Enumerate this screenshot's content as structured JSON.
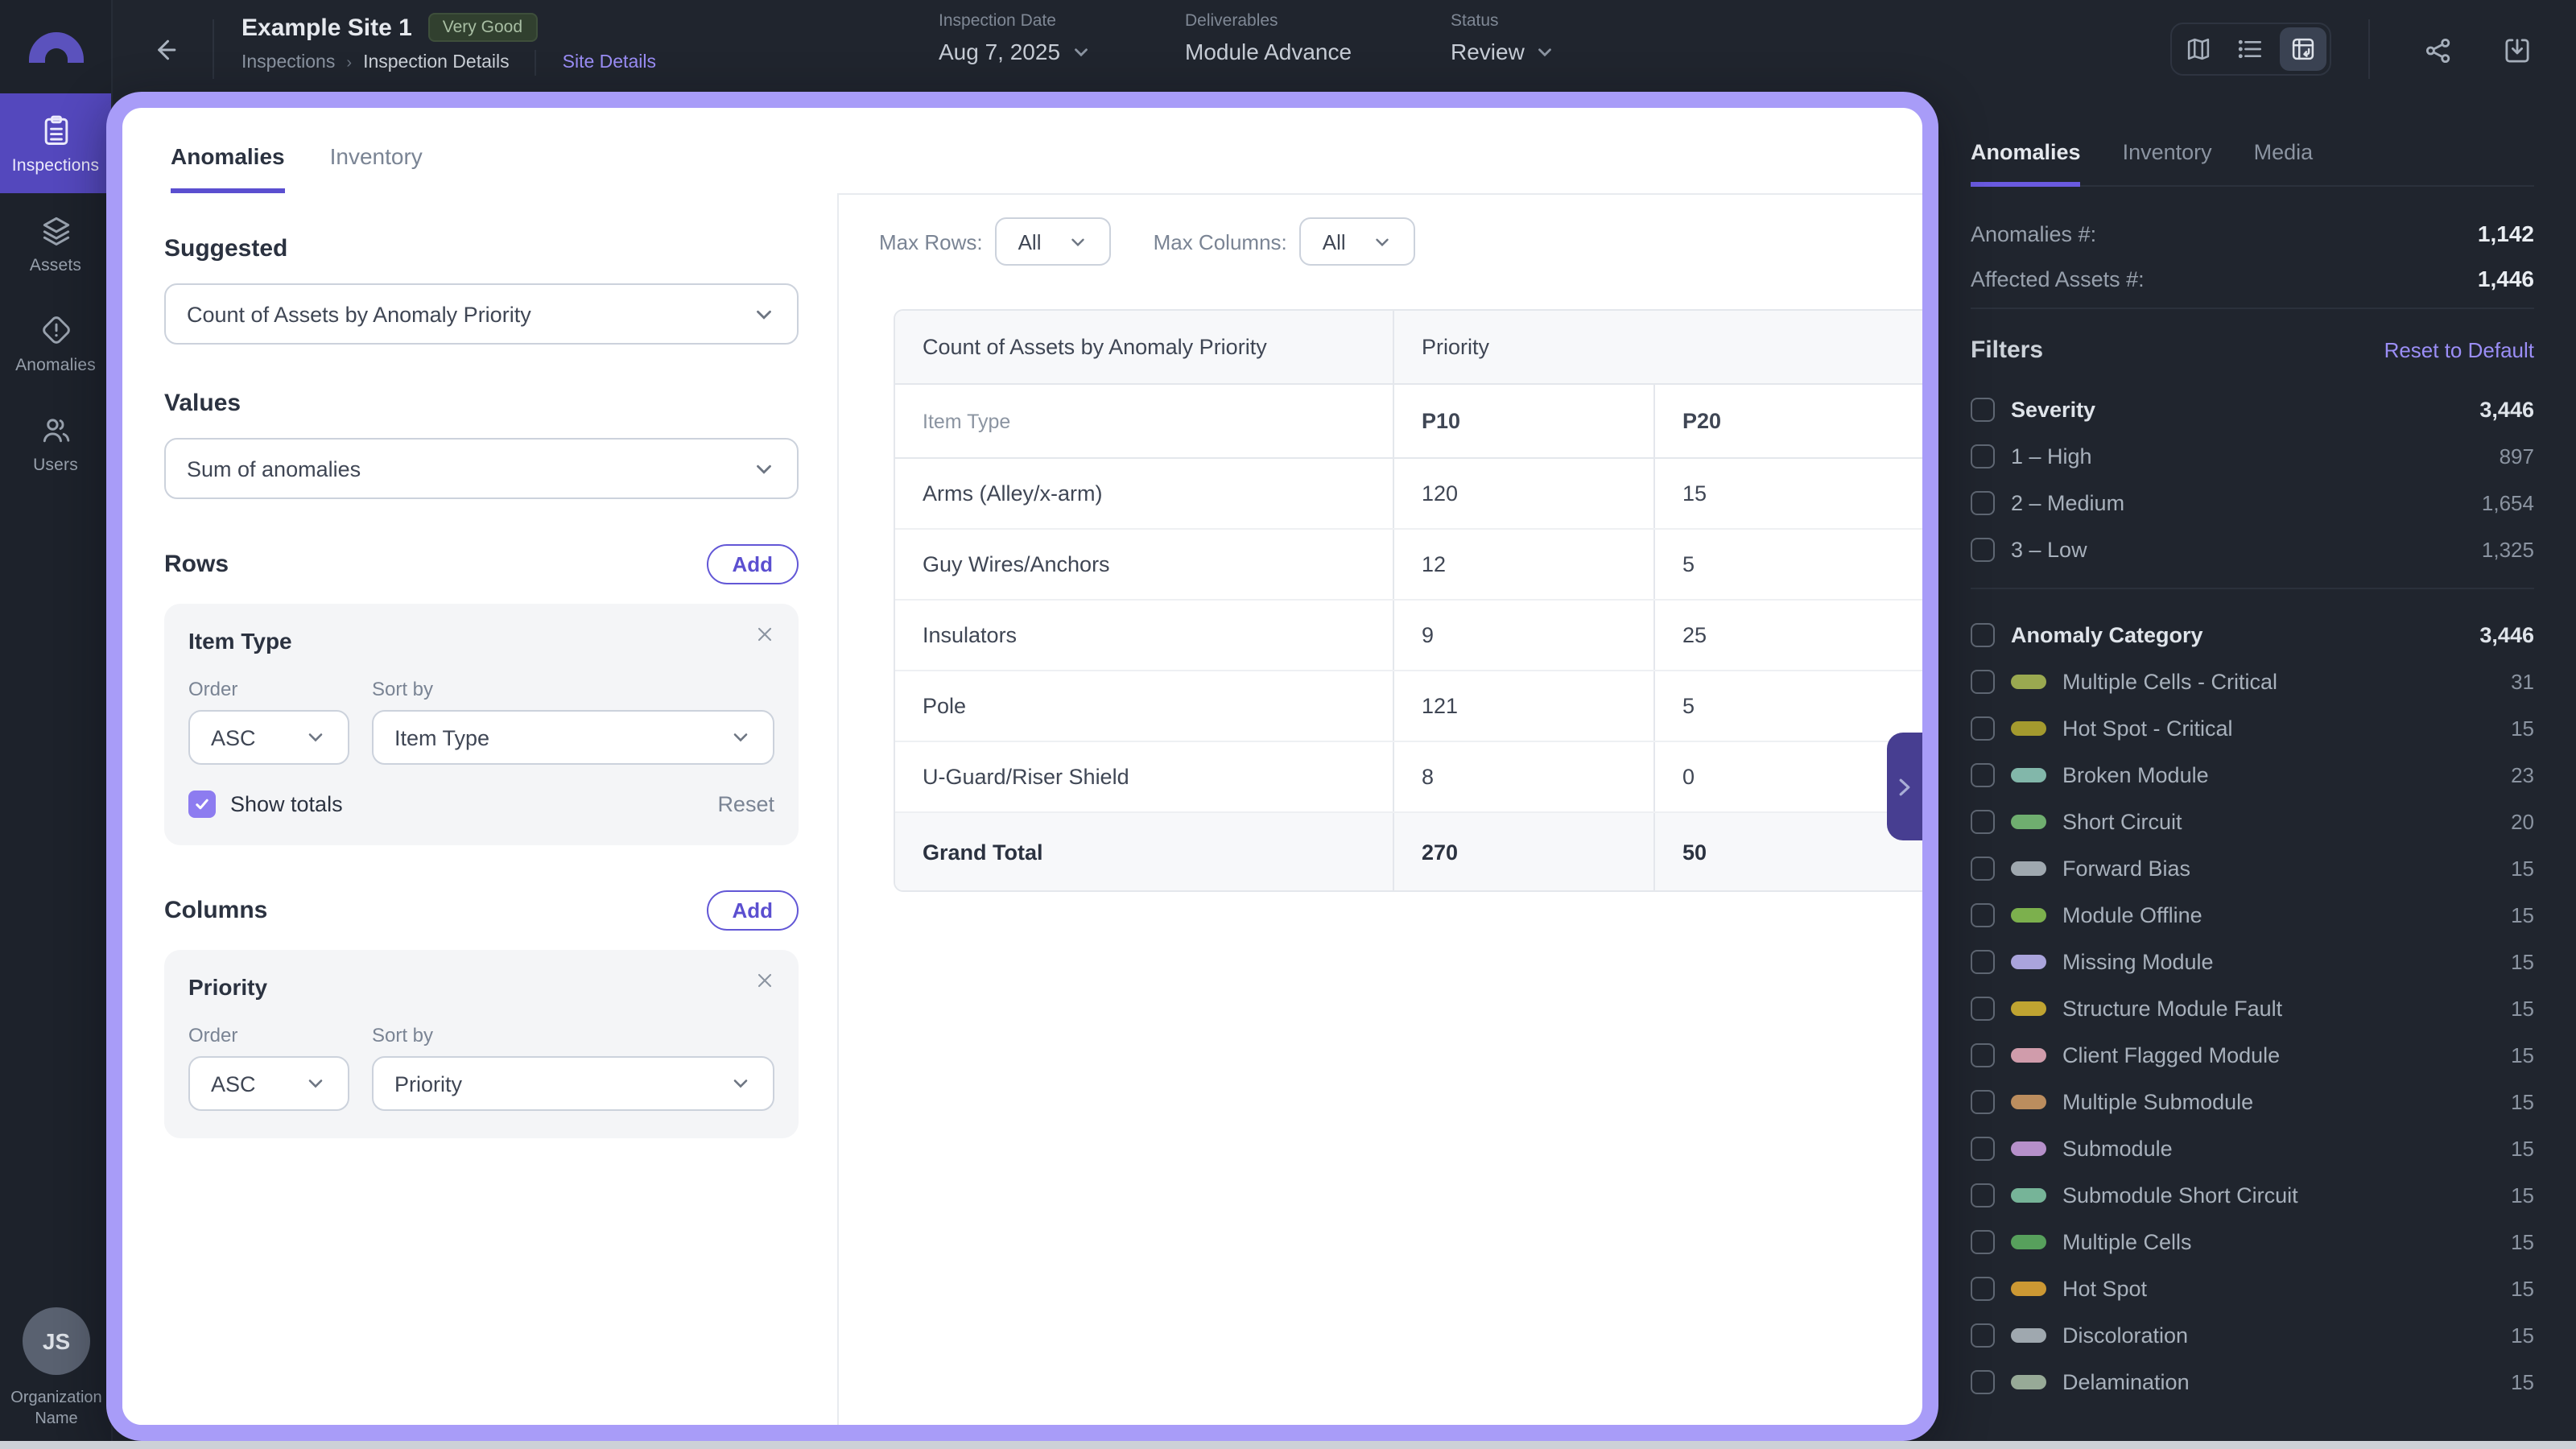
{
  "header": {
    "site_name": "Example Site 1",
    "rating_badge": "Very Good",
    "breadcrumb": {
      "items": [
        "Inspections",
        "Inspection Details"
      ],
      "separator": "›"
    },
    "site_details_link": "Site Details",
    "fields": [
      {
        "label": "Inspection Date",
        "value": "Aug 7, 2025",
        "has_dropdown": true
      },
      {
        "label": "Deliverables",
        "value": "Module Advance",
        "has_dropdown": false
      },
      {
        "label": "Status",
        "value": "Review",
        "has_dropdown": true
      }
    ],
    "view_icons": [
      "map-icon",
      "list-icon",
      "pivot-view-icon"
    ],
    "active_view_icon": "pivot-view-icon",
    "action_icons": [
      "share-icon",
      "download-icon"
    ]
  },
  "sidebar": {
    "logo_icon": "arch-logo",
    "items": [
      {
        "label": "Inspections",
        "icon": "clipboard-icon",
        "active": true
      },
      {
        "label": "Assets",
        "icon": "layers-icon",
        "active": false
      },
      {
        "label": "Anomalies",
        "icon": "alert-diamond-icon",
        "active": false
      },
      {
        "label": "Users",
        "icon": "users-icon",
        "active": false
      }
    ],
    "avatar_initials": "JS",
    "organization": "Organization Name"
  },
  "modal": {
    "tabs": [
      {
        "label": "Anomalies",
        "active": true
      },
      {
        "label": "Inventory",
        "active": false
      }
    ],
    "suggested": {
      "title": "Suggested",
      "value": "Count of Assets by Anomaly Priority"
    },
    "values": {
      "title": "Values",
      "value": "Sum of anomalies"
    },
    "rows_section": {
      "title": "Rows",
      "add_label": "Add",
      "card": {
        "title": "Item Type",
        "order_label": "Order",
        "order_value": "ASC",
        "sort_label": "Sort by",
        "sort_value": "Item Type",
        "show_totals_label": "Show totals",
        "show_totals_checked": true,
        "reset_label": "Reset"
      }
    },
    "columns_section": {
      "title": "Columns",
      "add_label": "Add",
      "card": {
        "title": "Priority",
        "order_label": "Order",
        "order_value": "ASC",
        "sort_label": "Sort by",
        "sort_value": "Priority"
      }
    },
    "table_controls": {
      "max_rows_label": "Max Rows:",
      "max_rows_value": "All",
      "max_columns_label": "Max Columns:",
      "max_columns_value": "All"
    },
    "pivot_table": {
      "group_header": "Count of Assets by Anomaly Priority",
      "column_group_label": "Priority",
      "row_dim_label": "Item Type",
      "columns": [
        "P10",
        "P20"
      ],
      "rows": [
        {
          "label": "Arms (Alley/x-arm)",
          "values": [
            "120",
            "15"
          ]
        },
        {
          "label": "Guy Wires/Anchors",
          "values": [
            "12",
            "5"
          ]
        },
        {
          "label": "Insulators",
          "values": [
            "9",
            "25"
          ]
        },
        {
          "label": "Pole",
          "values": [
            "121",
            "5"
          ]
        },
        {
          "label": "U-Guard/Riser Shield",
          "values": [
            "8",
            "0"
          ]
        }
      ],
      "grand_total": {
        "label": "Grand Total",
        "values": [
          "270",
          "50"
        ]
      }
    }
  },
  "right_panel": {
    "tabs": [
      {
        "label": "Anomalies",
        "active": true
      },
      {
        "label": "Inventory",
        "active": false
      },
      {
        "label": "Media",
        "active": false
      }
    ],
    "stats": [
      {
        "label": "Anomalies #:",
        "value": "1,142"
      },
      {
        "label": "Affected Assets #:",
        "value": "1,446"
      }
    ],
    "filters": {
      "title": "Filters",
      "reset_label": "Reset to Default",
      "groups": [
        {
          "label": "Severity",
          "count": "3,446",
          "items": [
            {
              "label": "1 – High",
              "count": "897"
            },
            {
              "label": "2 – Medium",
              "count": "1,654"
            },
            {
              "label": "3 – Low",
              "count": "1,325"
            }
          ]
        },
        {
          "label": "Anomaly Category",
          "count": "3,446",
          "items": [
            {
              "label": "Multiple Cells - Critical",
              "count": "31",
              "color": "#9aa950"
            },
            {
              "label": "Hot Spot - Critical",
              "count": "15",
              "color": "#a49a2e"
            },
            {
              "label": "Broken Module",
              "count": "23",
              "color": "#82b7aa"
            },
            {
              "label": "Short Circuit",
              "count": "20",
              "color": "#6fae6f"
            },
            {
              "label": "Forward Bias",
              "count": "15",
              "color": "#9fa8af"
            },
            {
              "label": "Module Offline",
              "count": "15",
              "color": "#7cb04d"
            },
            {
              "label": "Missing Module",
              "count": "15",
              "color": "#aaa4dc"
            },
            {
              "label": "Structure Module Fault",
              "count": "15",
              "color": "#c0a431"
            },
            {
              "label": "Client Flagged Module",
              "count": "15",
              "color": "#d09cab"
            },
            {
              "label": "Multiple Submodule",
              "count": "15",
              "color": "#bb8d5e"
            },
            {
              "label": "Submodule",
              "count": "15",
              "color": "#b690ca"
            },
            {
              "label": "Submodule Short Circuit",
              "count": "15",
              "color": "#76b498"
            },
            {
              "label": "Multiple Cells",
              "count": "15",
              "color": "#57a05c"
            },
            {
              "label": "Hot Spot",
              "count": "15",
              "color": "#cc9833"
            },
            {
              "label": "Discoloration",
              "count": "15",
              "color": "#9fa8af"
            },
            {
              "label": "Delamination",
              "count": "15",
              "color": "#97aa97"
            }
          ]
        }
      ]
    }
  },
  "colors": {
    "accent_purple": "#5b4fd0",
    "modal_border": "#a89cf8",
    "active_nav_purple": "#5448bd",
    "badge_green_bg": "#31402f",
    "badge_green_text": "#a9bfa4",
    "link_purple": "#9b8ef6",
    "dark_bg": "#20252e"
  }
}
